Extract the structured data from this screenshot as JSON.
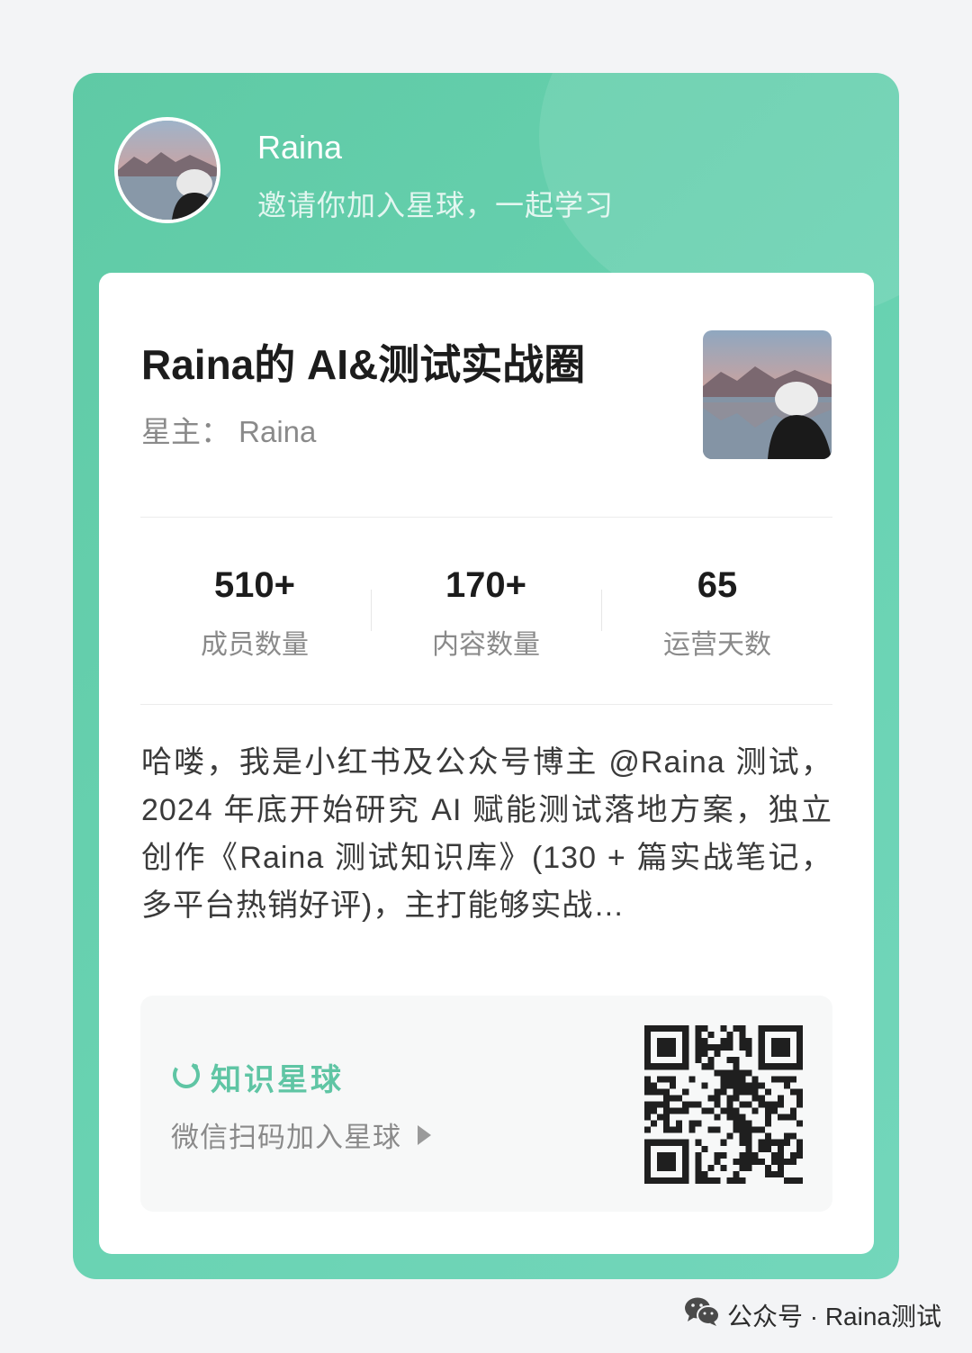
{
  "header": {
    "owner_name": "Raina",
    "invite_text": "邀请你加入星球，一起学习"
  },
  "circle": {
    "title": "Raina的 AI&测试实战圈",
    "host": "星主：  Raina"
  },
  "stats": [
    {
      "value": "510+",
      "label": "成员数量"
    },
    {
      "value": "170+",
      "label": "内容数量"
    },
    {
      "value": "65",
      "label": "运营天数"
    }
  ],
  "description": "哈喽，我是小红书及公众号博主 @Raina 测试，2024 年底开始研究 AI 赋能测试落地方案，独立创作《Raina 测试知识库》(130 + 篇实战笔记，多平台热销好评)，主打能够实战…",
  "join": {
    "brand": "知识星球",
    "scan_text": "微信扫码加入星球",
    "brand_icon": "planet-ring-icon",
    "arrow_icon": "play-arrow-icon"
  },
  "footer": {
    "text": "公众号 · Raina测试",
    "icon": "wechat-icon"
  },
  "colors": {
    "card_green": "#5fcaa5",
    "brand_green": "#5fc5a4"
  }
}
